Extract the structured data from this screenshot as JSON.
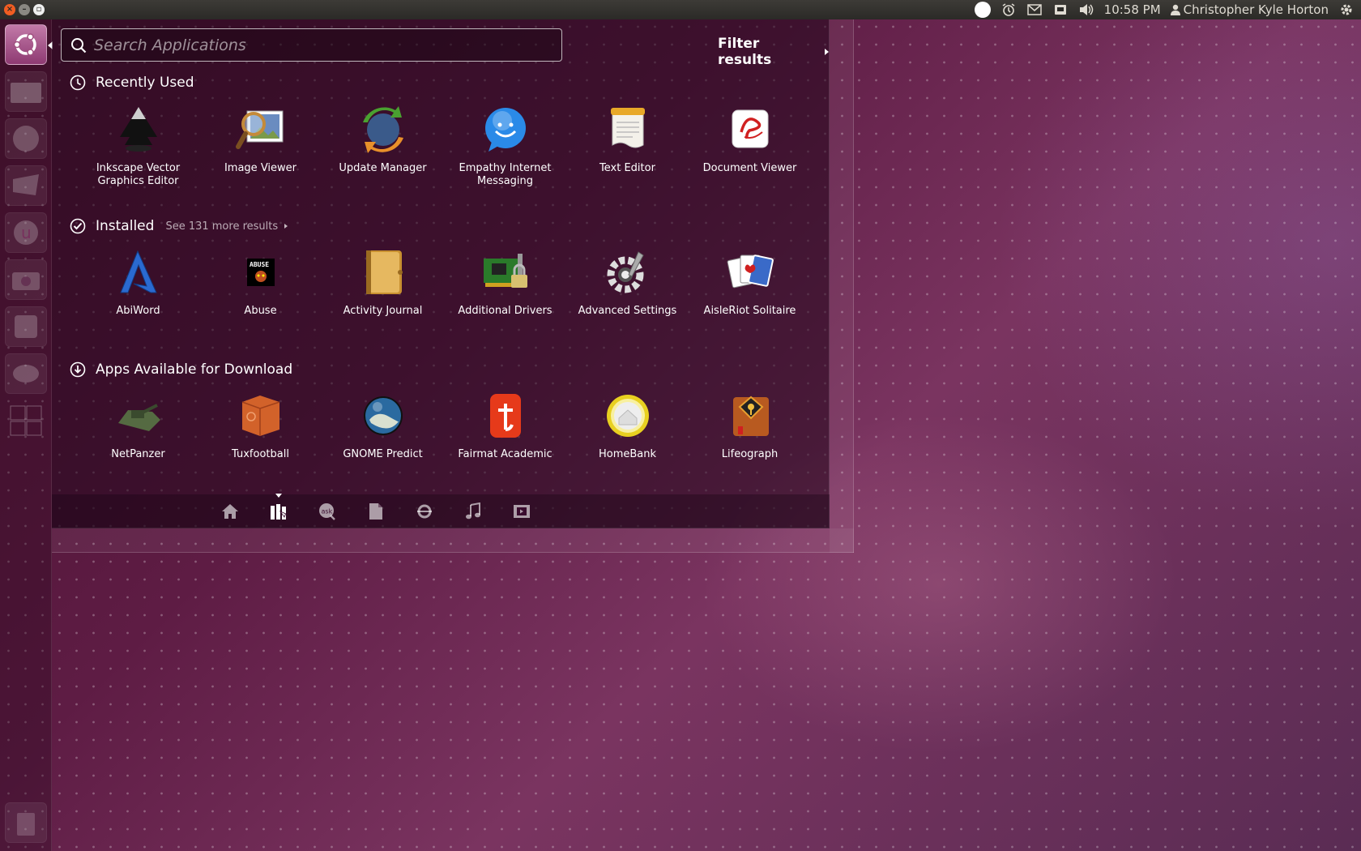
{
  "top_panel": {
    "clock": "10:58 PM",
    "user_name": "Christopher Kyle Horton",
    "indicators": [
      "status-circle-icon",
      "alarm-clock-icon",
      "mail-icon",
      "network-icon",
      "volume-icon"
    ]
  },
  "launcher": {
    "items": [
      "ubuntu-logo-icon",
      "folder-icon",
      "firefox-icon",
      "mail-client-icon",
      "ubuntu-one-icon",
      "camera-icon",
      "help-icon",
      "game-icon",
      "workspaces-icon",
      "trash-icon"
    ]
  },
  "search": {
    "placeholder": "Search Applications",
    "value": ""
  },
  "filter": {
    "label": "Filter results"
  },
  "sections": {
    "recent": {
      "title": "Recently Used",
      "apps": [
        {
          "label": "Inkscape Vector Graphics Editor",
          "icon": "inkscape-icon"
        },
        {
          "label": "Image Viewer",
          "icon": "image-viewer-icon"
        },
        {
          "label": "Update Manager",
          "icon": "update-manager-icon"
        },
        {
          "label": "Empathy Internet Messaging",
          "icon": "empathy-icon"
        },
        {
          "label": "Text Editor",
          "icon": "text-editor-icon"
        },
        {
          "label": "Document Viewer",
          "icon": "document-viewer-icon"
        }
      ]
    },
    "installed": {
      "title": "Installed",
      "see_more": "See 131 more results",
      "apps": [
        {
          "label": "AbiWord",
          "icon": "abiword-icon"
        },
        {
          "label": "Abuse",
          "icon": "abuse-icon"
        },
        {
          "label": "Activity Journal",
          "icon": "activity-journal-icon"
        },
        {
          "label": "Additional Drivers",
          "icon": "additional-drivers-icon"
        },
        {
          "label": "Advanced Settings",
          "icon": "advanced-settings-icon"
        },
        {
          "label": "AisleRiot Solitaire",
          "icon": "solitaire-icon"
        }
      ]
    },
    "download": {
      "title": "Apps Available for Download",
      "apps": [
        {
          "label": "NetPanzer",
          "icon": "netpanzer-icon"
        },
        {
          "label": "Tuxfootball",
          "icon": "tuxfootball-icon"
        },
        {
          "label": "GNOME Predict",
          "icon": "gnome-predict-icon"
        },
        {
          "label": "Fairmat Academic",
          "icon": "fairmat-icon"
        },
        {
          "label": "HomeBank",
          "icon": "homebank-icon"
        },
        {
          "label": "Lifeograph",
          "icon": "lifeograph-icon"
        }
      ]
    }
  },
  "lens_bar": {
    "lenses": [
      "home-lens-icon",
      "applications-lens-icon",
      "ask-lens-icon",
      "files-lens-icon",
      "social-lens-icon",
      "music-lens-icon",
      "video-lens-icon"
    ],
    "active": "applications-lens-icon"
  },
  "colors": {
    "accent": "#f15d22",
    "panel": "#2b2a27",
    "dash_bg": "#3a0c2e"
  }
}
